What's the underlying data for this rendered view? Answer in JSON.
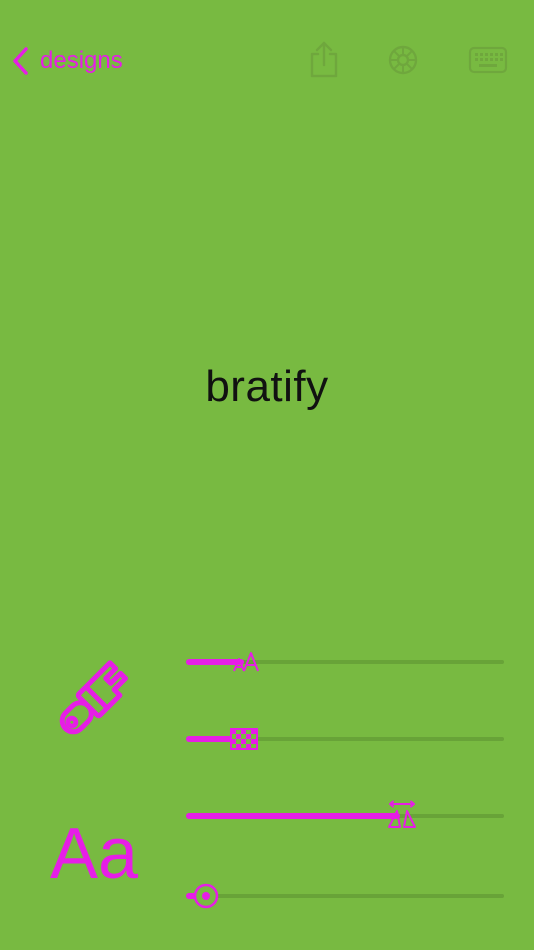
{
  "nav": {
    "back_label": "designs",
    "icons": [
      "share-icon",
      "settings-icon",
      "keyboard-icon"
    ]
  },
  "preview": {
    "text": "bratify"
  },
  "controls": {
    "color_icon": "paintbrush-icon",
    "font_icon_label": "Aa",
    "sliders": [
      {
        "name": "font-size",
        "value": 0.18
      },
      {
        "name": "opacity",
        "value": 0.19
      },
      {
        "name": "letter-spacing",
        "value": 0.68
      },
      {
        "name": "blur",
        "value": 0.05
      }
    ]
  },
  "colors": {
    "background": "#78BA41",
    "accent": "#E61EE6",
    "muted_icon": "#6FA63D",
    "text": "#111111"
  }
}
